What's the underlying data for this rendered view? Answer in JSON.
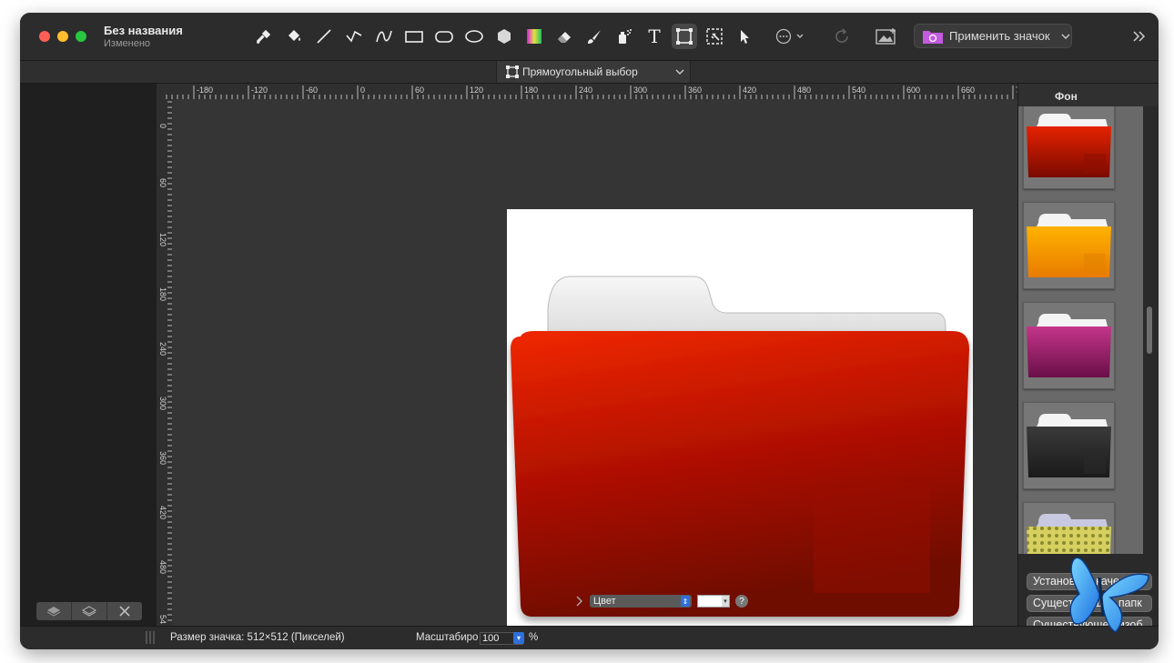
{
  "window": {
    "title": "Без названия",
    "subtitle": "Изменено"
  },
  "toolbar": {
    "tools": [
      "eyedropper-icon",
      "bucket-icon",
      "line-icon",
      "polyline-icon",
      "curve-icon",
      "rectangle-icon",
      "rounded-rect-icon",
      "ellipse-icon",
      "polygon-icon",
      "gradient-icon",
      "eraser-icon",
      "brush-icon",
      "spray-icon",
      "text-icon",
      "rect-select-icon",
      "magic-select-icon",
      "pointer-icon",
      "more-icon",
      "redo-icon",
      "image-icon"
    ],
    "active_tool": "rect-select-icon",
    "apply_label": "Применить значок",
    "text_tool_glyph": "T"
  },
  "subbar": {
    "selection_mode": "Прямоугольный выбор"
  },
  "ruler": {
    "h_labels": [
      "-180",
      "-120",
      "-60",
      "0",
      "60",
      "120",
      "180",
      "240",
      "300",
      "360",
      "420",
      "480",
      "540",
      "600",
      "660",
      "7"
    ],
    "v_labels": [
      "0",
      "60",
      "120",
      "180",
      "240",
      "300",
      "360",
      "420",
      "480",
      "54"
    ]
  },
  "canvas_footer": {
    "fill_label": "Цвет",
    "help": "?"
  },
  "right_panel": {
    "header": "Фон",
    "thumbnails": [
      "red-folder",
      "orange-folder",
      "magenta-folder",
      "black-folder",
      "yellow-pattern-folder"
    ],
    "buttons": [
      "Установить качест",
      "Существующая папк",
      "Существующее изоб"
    ]
  },
  "status": {
    "size_label": "Размер значка: 512×512 (Пикселей)",
    "zoom_label": "Масштабиро",
    "zoom_value": "100",
    "zoom_unit": "%"
  },
  "colors": {
    "folder_top": "#ee2200",
    "folder_bottom": "#7a0a00",
    "accent_blue": "#2f6fdc"
  }
}
